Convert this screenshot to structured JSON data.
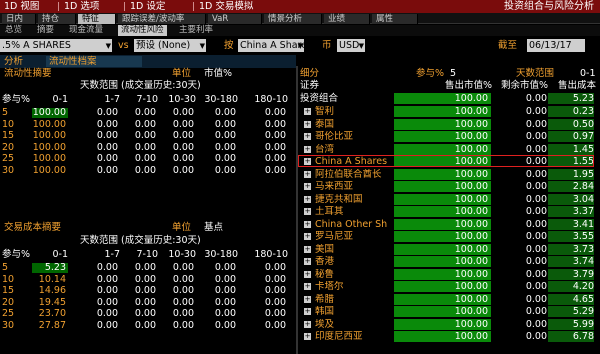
{
  "menubar": {
    "items": [
      "1D 视图",
      "1D 选项",
      "1D 设定",
      "1D 交易模拟"
    ],
    "title": "投资组合与风险分析"
  },
  "tabs_row1": [
    "日内",
    "持仓",
    "特征",
    "跟踪误差/波动率",
    "VaR",
    "情景分析",
    "业绩",
    "属性"
  ],
  "tabs_row1_active": 2,
  "tabs_row2": [
    "总览",
    "摘要",
    "现金流量",
    "流动性风险",
    "主要利率"
  ],
  "tabs_row2_active": 3,
  "controls": {
    "portfolio": ".5% A SHARES",
    "vs_label": "vs",
    "benchmark": "预设 (None)",
    "by_label": "按",
    "group": "China A Share",
    "currency_label": "币",
    "currency": "USD",
    "asof_label": "截至",
    "asof": "06/13/17"
  },
  "analysis": {
    "label": "分析",
    "value": "流动性档案"
  },
  "liquidity_summary": {
    "title": "流动性摘要",
    "unit_label": "单位",
    "unit_value": "市值%",
    "range_header": "天数范围 (成交量历史:30天)",
    "participation_label": "参与%",
    "columns": [
      "0-1",
      "1-7",
      "7-10",
      "10-30",
      "30-180",
      "180-10"
    ],
    "rows": [
      {
        "p": "5",
        "vals": [
          "100.00",
          "0.00",
          "0.00",
          "0.00",
          "0.00",
          "0.00"
        ]
      },
      {
        "p": "10",
        "vals": [
          "100.00",
          "0.00",
          "0.00",
          "0.00",
          "0.00",
          "0.00"
        ]
      },
      {
        "p": "15",
        "vals": [
          "100.00",
          "0.00",
          "0.00",
          "0.00",
          "0.00",
          "0.00"
        ]
      },
      {
        "p": "20",
        "vals": [
          "100.00",
          "0.00",
          "0.00",
          "0.00",
          "0.00",
          "0.00"
        ]
      },
      {
        "p": "25",
        "vals": [
          "100.00",
          "0.00",
          "0.00",
          "0.00",
          "0.00",
          "0.00"
        ]
      },
      {
        "p": "30",
        "vals": [
          "100.00",
          "0.00",
          "0.00",
          "0.00",
          "0.00",
          "0.00"
        ]
      }
    ]
  },
  "trading_cost_summary": {
    "title": "交易成本摘要",
    "unit_label": "单位",
    "unit_value": "基点",
    "range_header": "天数范围 (成交量历史:30天)",
    "participation_label": "参与%",
    "columns": [
      "0-1",
      "1-7",
      "7-10",
      "10-30",
      "30-180",
      "180-10"
    ],
    "rows": [
      {
        "p": "5",
        "vals": [
          "5.23",
          "0.00",
          "0.00",
          "0.00",
          "0.00",
          "0.00"
        ]
      },
      {
        "p": "10",
        "vals": [
          "10.14",
          "0.00",
          "0.00",
          "0.00",
          "0.00",
          "0.00"
        ]
      },
      {
        "p": "15",
        "vals": [
          "14.96",
          "0.00",
          "0.00",
          "0.00",
          "0.00",
          "0.00"
        ]
      },
      {
        "p": "20",
        "vals": [
          "19.45",
          "0.00",
          "0.00",
          "0.00",
          "0.00",
          "0.00"
        ]
      },
      {
        "p": "25",
        "vals": [
          "23.70",
          "0.00",
          "0.00",
          "0.00",
          "0.00",
          "0.00"
        ]
      },
      {
        "p": "30",
        "vals": [
          "27.87",
          "0.00",
          "0.00",
          "0.00",
          "0.00",
          "0.00"
        ]
      }
    ]
  },
  "breakdown": {
    "title": "细分",
    "participation_label": "参与%",
    "participation_value": "5",
    "days_range_label": "天数范围",
    "days_range_value": "0-1",
    "col_security": "证券",
    "col_sell_mv": "售出市值%",
    "col_remaining_mv": "剩余市值%",
    "col_sell_cost": "售出成本",
    "total": {
      "name": "投资组合",
      "sell": "100.00",
      "remain": "0.00",
      "cost": "5.23"
    },
    "rows": [
      {
        "name": "智利",
        "sell": "100.00",
        "remain": "0.00",
        "cost": "0.23"
      },
      {
        "name": "泰国",
        "sell": "100.00",
        "remain": "0.00",
        "cost": "0.50"
      },
      {
        "name": "哥伦比亚",
        "sell": "100.00",
        "remain": "0.00",
        "cost": "0.97"
      },
      {
        "name": "台湾",
        "sell": "100.00",
        "remain": "0.00",
        "cost": "1.45"
      },
      {
        "name": "China A Shares",
        "sell": "100.00",
        "remain": "0.00",
        "cost": "1.55"
      },
      {
        "name": "阿拉伯联合酋长",
        "sell": "100.00",
        "remain": "0.00",
        "cost": "1.95"
      },
      {
        "name": "马来西亚",
        "sell": "100.00",
        "remain": "0.00",
        "cost": "2.84"
      },
      {
        "name": "捷克共和国",
        "sell": "100.00",
        "remain": "0.00",
        "cost": "3.04"
      },
      {
        "name": "土耳其",
        "sell": "100.00",
        "remain": "0.00",
        "cost": "3.37"
      },
      {
        "name": "China Other Shar",
        "sell": "100.00",
        "remain": "0.00",
        "cost": "3.41"
      },
      {
        "name": "罗马尼亚",
        "sell": "100.00",
        "remain": "0.00",
        "cost": "3.55"
      },
      {
        "name": "美国",
        "sell": "100.00",
        "remain": "0.00",
        "cost": "3.73"
      },
      {
        "name": "香港",
        "sell": "100.00",
        "remain": "0.00",
        "cost": "3.74"
      },
      {
        "name": "秘鲁",
        "sell": "100.00",
        "remain": "0.00",
        "cost": "3.79"
      },
      {
        "name": "卡塔尔",
        "sell": "100.00",
        "remain": "0.00",
        "cost": "4.20"
      },
      {
        "name": "希腊",
        "sell": "100.00",
        "remain": "0.00",
        "cost": "4.65"
      },
      {
        "name": "韩国",
        "sell": "100.00",
        "remain": "0.00",
        "cost": "5.29"
      },
      {
        "name": "埃及",
        "sell": "100.00",
        "remain": "0.00",
        "cost": "5.99"
      },
      {
        "name": "印度尼西亚",
        "sell": "100.00",
        "remain": "0.00",
        "cost": "6.78"
      }
    ],
    "selected_index": 4
  },
  "colors": {
    "menubar": "#7a0c0c",
    "accent_orange": "#f0a030",
    "bar_green": "#0a8a0a",
    "selection_red": "#e02020"
  }
}
